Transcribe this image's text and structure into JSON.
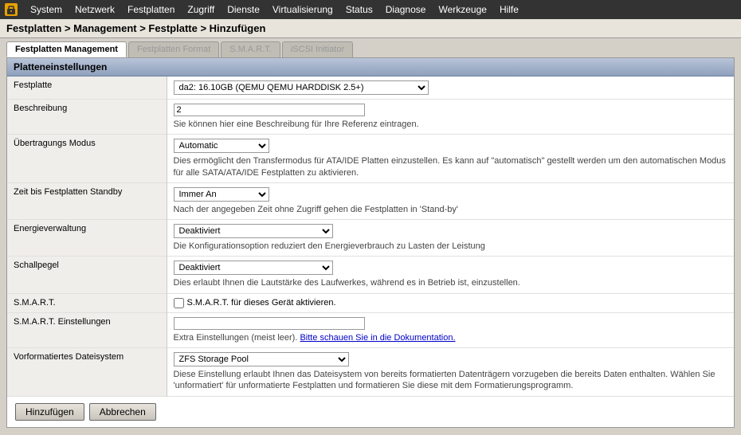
{
  "menubar": {
    "logo_unicode": "🔒",
    "items": [
      "System",
      "Netzwerk",
      "Festplatten",
      "Zugriff",
      "Dienste",
      "Virtualisierung",
      "Status",
      "Diagnose",
      "Werkzeuge",
      "Hilfe"
    ]
  },
  "breadcrumb": {
    "text": "Festplatten > Management > Festplatte > Hinzufügen"
  },
  "tabs": [
    {
      "label": "Festplatten Management",
      "active": true
    },
    {
      "label": "Festplatten Format",
      "active": false
    },
    {
      "label": "S.M.A.R.T.",
      "active": false
    },
    {
      "label": "iSCSI Initiator",
      "active": false
    }
  ],
  "section": {
    "title": "Platteneinstellungen"
  },
  "fields": {
    "festplatte": {
      "label": "Festplatte",
      "select_value": "da2: 16.10GB (QEMU QEMU HARDDISK 2.5+)",
      "options": [
        "da2: 16.10GB (QEMU QEMU HARDDISK 2.5+)"
      ]
    },
    "beschreibung": {
      "label": "Beschreibung",
      "value": "2",
      "hint": "Sie können hier eine Beschreibung für Ihre Referenz eintragen."
    },
    "uebertragungsmodus": {
      "label": "Übertragungs Modus",
      "select_value": "Automatic",
      "options": [
        "Automatic"
      ],
      "hint": "Dies ermöglicht den Transfermodus für ATA/IDE Platten einzustellen. Es kann auf \"automatisch\" gestellt werden um den automatischen Modus für alle SATA/ATA/IDE Festplatten zu aktivieren."
    },
    "standby": {
      "label": "Zeit bis Festplatten Standby",
      "select_value": "Immer An",
      "options": [
        "Immer An"
      ],
      "hint": "Nach der angegeben Zeit ohne Zugriff gehen die Festplatten in 'Stand-by'"
    },
    "energieverwaltung": {
      "label": "Energieverwaltung",
      "select_value": "Deaktiviert",
      "options": [
        "Deaktiviert"
      ],
      "hint": "Die Konfigurationsoption reduziert den Energieverbrauch zu Lasten der Leistung"
    },
    "schallpegel": {
      "label": "Schallpegel",
      "select_value": "Deaktiviert",
      "options": [
        "Deaktiviert"
      ],
      "hint": "Dies erlaubt Ihnen die Lautstärke des Laufwerkes, während es in Betrieb ist, einzustellen."
    },
    "smart": {
      "label": "S.M.A.R.T.",
      "checkbox_label": "S.M.A.R.T. für dieses Gerät aktivieren."
    },
    "smart_einstellungen": {
      "label": "S.M.A.R.T. Einstellungen",
      "value": "",
      "hint_normal": "Extra Einstellungen (meist leer). ",
      "hint_link": "Bitte schauen Sie in die Dokumentation.",
      "hint_link_url": "#"
    },
    "vorformatiertes_dateisystem": {
      "label": "Vorformatiertes Dateisystem",
      "select_value": "ZFS Storage Pool",
      "options": [
        "ZFS Storage Pool"
      ],
      "hint": "Diese Einstellung erlaubt Ihnen das Dateisystem von bereits formatierten Datenträgern vorzugeben die bereits Daten enthalten. Wählen Sie 'unformatiert' für unformatierte Festplatten und formatieren Sie diese mit dem Formatierungsprogramm."
    }
  },
  "buttons": {
    "add": "Hinzufügen",
    "cancel": "Abbrechen"
  }
}
